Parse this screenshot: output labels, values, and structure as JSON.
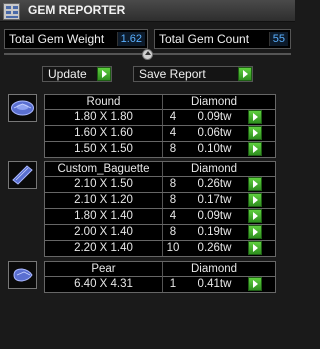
{
  "window": {
    "title": "GEM REPORTER"
  },
  "stats": {
    "total_weight_label": "Total Gem Weight",
    "total_weight_value": "1.62",
    "total_count_label": "Total Gem Count",
    "total_count_value": "55"
  },
  "toolbar": {
    "update_label": "Update",
    "save_label": "Save Report"
  },
  "groups": [
    {
      "shape_icon": "round-gem-icon",
      "cut": "Round",
      "stone": "Diamond",
      "rows": [
        {
          "size": "1.80 X 1.80",
          "qty": "4",
          "weight": "0.09tw"
        },
        {
          "size": "1.60 X 1.60",
          "qty": "4",
          "weight": "0.06tw"
        },
        {
          "size": "1.50 X 1.50",
          "qty": "8",
          "weight": "0.10tw"
        }
      ]
    },
    {
      "shape_icon": "baguette-gem-icon",
      "cut": "Custom_Baguette",
      "stone": "Diamond",
      "rows": [
        {
          "size": "2.10 X 1.50",
          "qty": "8",
          "weight": "0.26tw"
        },
        {
          "size": "2.10 X 1.20",
          "qty": "8",
          "weight": "0.17tw"
        },
        {
          "size": "1.80 X 1.40",
          "qty": "4",
          "weight": "0.09tw"
        },
        {
          "size": "2.00 X 1.40",
          "qty": "8",
          "weight": "0.19tw"
        },
        {
          "size": "2.20 X 1.40",
          "qty": "10",
          "weight": "0.26tw"
        }
      ]
    },
    {
      "shape_icon": "pear-gem-icon",
      "cut": "Pear",
      "stone": "Diamond",
      "rows": [
        {
          "size": "6.40 X 4.31",
          "qty": "1",
          "weight": "0.41tw"
        }
      ]
    }
  ],
  "colors": {
    "accent_value": "#5ab0ff",
    "go_green": "#4cbb33"
  }
}
